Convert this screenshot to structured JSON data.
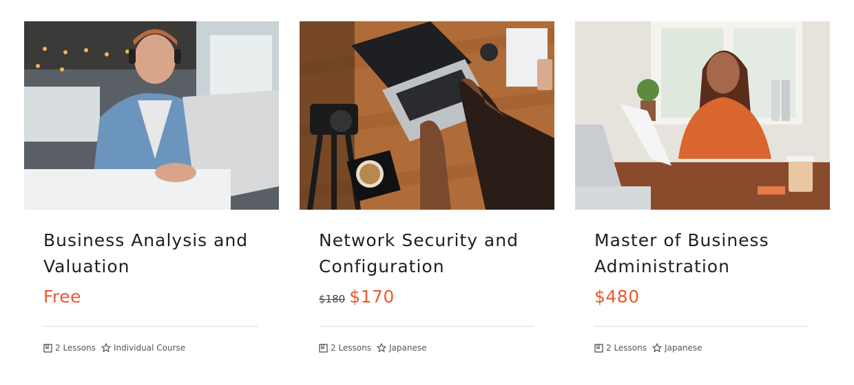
{
  "courses": [
    {
      "title": "Business Analysis and Valuation",
      "price": "Free",
      "old_price": "",
      "lessons": "2 Lessons",
      "tag": "Individual Course",
      "image_icon": "man-with-headphones-at-laptop-photo",
      "price_color": "#e8582f"
    },
    {
      "title": "Network Security and Configuration",
      "price": "$170",
      "old_price": "$180",
      "lessons": "2 Lessons",
      "tag": "Japanese",
      "image_icon": "desk-with-laptop-camera-coffee-photo",
      "price_color": "#e8582f"
    },
    {
      "title": "Master of Business Administration",
      "price": "$480",
      "old_price": "",
      "lessons": "2 Lessons",
      "tag": "Japanese",
      "image_icon": "woman-reading-document-at-desk-photo",
      "price_color": "#e8582f"
    }
  ],
  "icons": {
    "lessons": "book-icon",
    "tag": "star-icon"
  }
}
